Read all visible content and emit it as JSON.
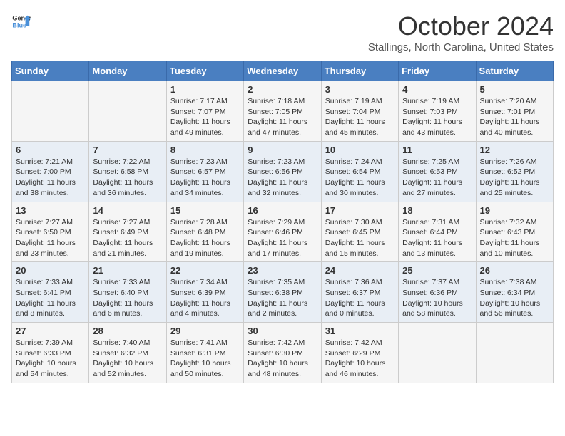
{
  "header": {
    "logo_line1": "General",
    "logo_line2": "Blue",
    "month": "October 2024",
    "location": "Stallings, North Carolina, United States"
  },
  "weekdays": [
    "Sunday",
    "Monday",
    "Tuesday",
    "Wednesday",
    "Thursday",
    "Friday",
    "Saturday"
  ],
  "weeks": [
    [
      {
        "day": "",
        "info": ""
      },
      {
        "day": "",
        "info": ""
      },
      {
        "day": "1",
        "info": "Sunrise: 7:17 AM\nSunset: 7:07 PM\nDaylight: 11 hours and 49 minutes."
      },
      {
        "day": "2",
        "info": "Sunrise: 7:18 AM\nSunset: 7:05 PM\nDaylight: 11 hours and 47 minutes."
      },
      {
        "day": "3",
        "info": "Sunrise: 7:19 AM\nSunset: 7:04 PM\nDaylight: 11 hours and 45 minutes."
      },
      {
        "day": "4",
        "info": "Sunrise: 7:19 AM\nSunset: 7:03 PM\nDaylight: 11 hours and 43 minutes."
      },
      {
        "day": "5",
        "info": "Sunrise: 7:20 AM\nSunset: 7:01 PM\nDaylight: 11 hours and 40 minutes."
      }
    ],
    [
      {
        "day": "6",
        "info": "Sunrise: 7:21 AM\nSunset: 7:00 PM\nDaylight: 11 hours and 38 minutes."
      },
      {
        "day": "7",
        "info": "Sunrise: 7:22 AM\nSunset: 6:58 PM\nDaylight: 11 hours and 36 minutes."
      },
      {
        "day": "8",
        "info": "Sunrise: 7:23 AM\nSunset: 6:57 PM\nDaylight: 11 hours and 34 minutes."
      },
      {
        "day": "9",
        "info": "Sunrise: 7:23 AM\nSunset: 6:56 PM\nDaylight: 11 hours and 32 minutes."
      },
      {
        "day": "10",
        "info": "Sunrise: 7:24 AM\nSunset: 6:54 PM\nDaylight: 11 hours and 30 minutes."
      },
      {
        "day": "11",
        "info": "Sunrise: 7:25 AM\nSunset: 6:53 PM\nDaylight: 11 hours and 27 minutes."
      },
      {
        "day": "12",
        "info": "Sunrise: 7:26 AM\nSunset: 6:52 PM\nDaylight: 11 hours and 25 minutes."
      }
    ],
    [
      {
        "day": "13",
        "info": "Sunrise: 7:27 AM\nSunset: 6:50 PM\nDaylight: 11 hours and 23 minutes."
      },
      {
        "day": "14",
        "info": "Sunrise: 7:27 AM\nSunset: 6:49 PM\nDaylight: 11 hours and 21 minutes."
      },
      {
        "day": "15",
        "info": "Sunrise: 7:28 AM\nSunset: 6:48 PM\nDaylight: 11 hours and 19 minutes."
      },
      {
        "day": "16",
        "info": "Sunrise: 7:29 AM\nSunset: 6:46 PM\nDaylight: 11 hours and 17 minutes."
      },
      {
        "day": "17",
        "info": "Sunrise: 7:30 AM\nSunset: 6:45 PM\nDaylight: 11 hours and 15 minutes."
      },
      {
        "day": "18",
        "info": "Sunrise: 7:31 AM\nSunset: 6:44 PM\nDaylight: 11 hours and 13 minutes."
      },
      {
        "day": "19",
        "info": "Sunrise: 7:32 AM\nSunset: 6:43 PM\nDaylight: 11 hours and 10 minutes."
      }
    ],
    [
      {
        "day": "20",
        "info": "Sunrise: 7:33 AM\nSunset: 6:41 PM\nDaylight: 11 hours and 8 minutes."
      },
      {
        "day": "21",
        "info": "Sunrise: 7:33 AM\nSunset: 6:40 PM\nDaylight: 11 hours and 6 minutes."
      },
      {
        "day": "22",
        "info": "Sunrise: 7:34 AM\nSunset: 6:39 PM\nDaylight: 11 hours and 4 minutes."
      },
      {
        "day": "23",
        "info": "Sunrise: 7:35 AM\nSunset: 6:38 PM\nDaylight: 11 hours and 2 minutes."
      },
      {
        "day": "24",
        "info": "Sunrise: 7:36 AM\nSunset: 6:37 PM\nDaylight: 11 hours and 0 minutes."
      },
      {
        "day": "25",
        "info": "Sunrise: 7:37 AM\nSunset: 6:36 PM\nDaylight: 10 hours and 58 minutes."
      },
      {
        "day": "26",
        "info": "Sunrise: 7:38 AM\nSunset: 6:34 PM\nDaylight: 10 hours and 56 minutes."
      }
    ],
    [
      {
        "day": "27",
        "info": "Sunrise: 7:39 AM\nSunset: 6:33 PM\nDaylight: 10 hours and 54 minutes."
      },
      {
        "day": "28",
        "info": "Sunrise: 7:40 AM\nSunset: 6:32 PM\nDaylight: 10 hours and 52 minutes."
      },
      {
        "day": "29",
        "info": "Sunrise: 7:41 AM\nSunset: 6:31 PM\nDaylight: 10 hours and 50 minutes."
      },
      {
        "day": "30",
        "info": "Sunrise: 7:42 AM\nSunset: 6:30 PM\nDaylight: 10 hours and 48 minutes."
      },
      {
        "day": "31",
        "info": "Sunrise: 7:42 AM\nSunset: 6:29 PM\nDaylight: 10 hours and 46 minutes."
      },
      {
        "day": "",
        "info": ""
      },
      {
        "day": "",
        "info": ""
      }
    ]
  ]
}
